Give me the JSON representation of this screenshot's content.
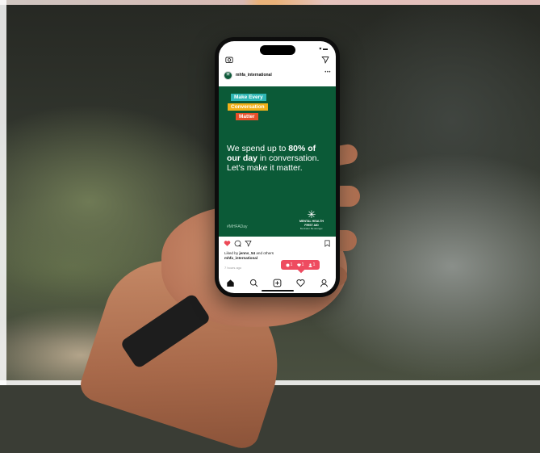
{
  "scene": {
    "description_icons": [
      "hand",
      "smartphone",
      "wristband"
    ]
  },
  "status": {
    "signal": "▾ ▬"
  },
  "app": {
    "header_icons": [
      "camera-icon",
      "send-icon"
    ]
  },
  "post": {
    "username": "mhfa_international",
    "more": "•••",
    "image": {
      "tags": [
        "Make Every",
        "Conversation",
        "Matter"
      ],
      "headline_pre": "We spend up to ",
      "headline_bold": "80% of our day",
      "headline_post": " in conversation. Let's make it matter.",
      "hashtag": "#MHFADay",
      "brand_name_line1": "MENTAL HEALTH",
      "brand_name_line2": "FIRST AID",
      "brand_tagline": "Be kinder. Be stronger.",
      "colors": {
        "background": "#0b5a37",
        "tag1": "#2fb7b5",
        "tag2": "#f2b11a",
        "tag3": "#e8502a"
      }
    },
    "liked_by_prefix": "Liked by ",
    "liked_by_user": "jenns_54",
    "liked_by_suffix": " and others",
    "caption_user": "mhfa_international",
    "timestamp": "7 hours ago"
  },
  "notification": {
    "comments": "1",
    "likes": "1",
    "follows": "1",
    "color": "#ee4b60"
  },
  "nav": {
    "items": [
      "home-icon",
      "search-icon",
      "add-post-icon",
      "activity-icon",
      "profile-icon"
    ]
  }
}
